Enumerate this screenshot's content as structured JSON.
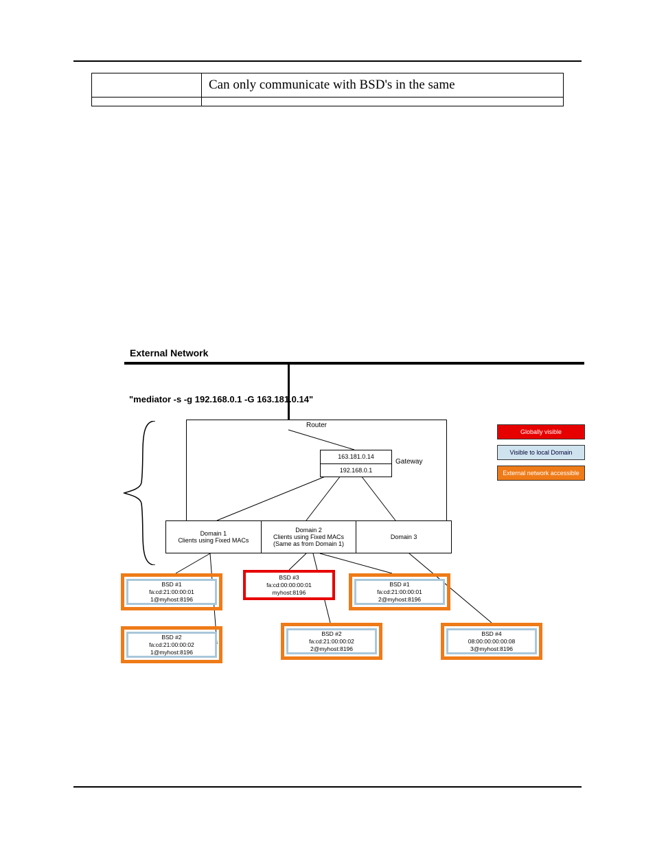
{
  "table": {
    "row1_col2": "Can only communicate with BSD's in the same",
    "row2_col1": "",
    "row2_col2": ""
  },
  "figure": {
    "external_title": "External Network",
    "command": "\"mediator -s -g 192.168.0.1 -G 163.181.0.14\"",
    "router_label": "Router",
    "gateway_label": "Gateway",
    "gateway_ip_ext": "163.181.0.14",
    "gateway_ip_int": "192.168.0.1",
    "domains": {
      "d1_name": "Domain 1",
      "d1_sub": "Clients using Fixed MACs",
      "d2_name": "Domain 2",
      "d2_sub1": "Clients using Fixed MACs",
      "d2_sub2": "(Same as from Domain 1)",
      "d3_name": "Domain 3"
    },
    "legend": {
      "red": "Globally visible",
      "blue": "Visible to local Domain",
      "orange": "External network accessible"
    },
    "bsd": {
      "b1_name": "BSD #1",
      "b1_mac": "fa:cd:21:00:00:01",
      "b1_host": "1@myhost:8196",
      "b2_name": "BSD #2",
      "b2_mac": "fa:cd:21:00:00:02",
      "b2_host": "1@myhost:8196",
      "b3_name": "BSD #3",
      "b3_mac": "fa:cd:00:00:00:01",
      "b3_host": "myhost:8196",
      "b4_name": "BSD #2",
      "b4_mac": "fa:cd:21:00:00:02",
      "b4_host": "2@myhost:8196",
      "b5_name": "BSD #1",
      "b5_mac": "fa:cd:21:00:00:01",
      "b5_host": "2@myhost:8196",
      "b6_name": "BSD #4",
      "b6_mac": "08:00:00:00:00:08",
      "b6_host": "3@myhost:8196"
    }
  }
}
